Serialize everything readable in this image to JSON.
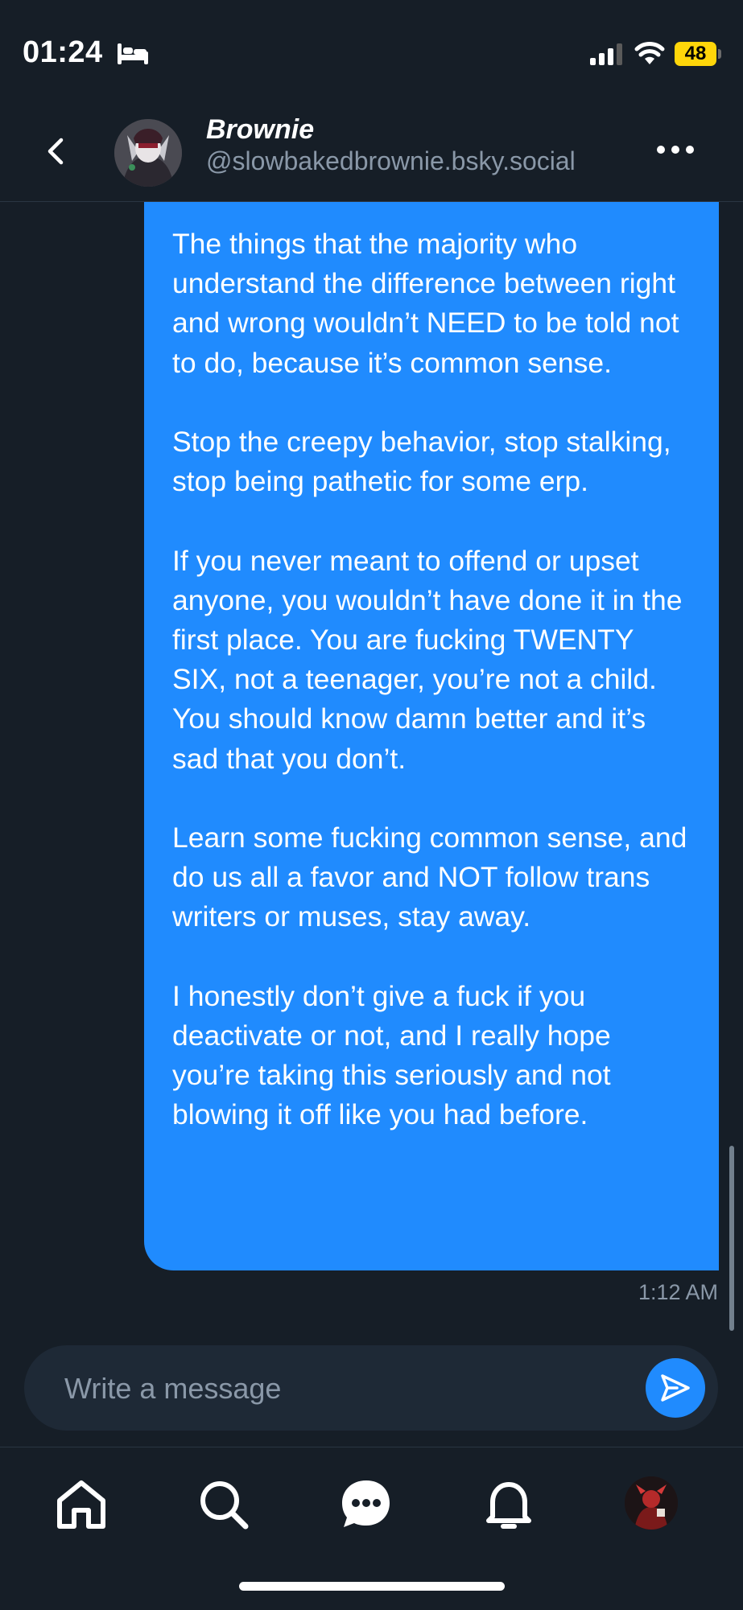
{
  "status_bar": {
    "time": "01:24",
    "battery": "48"
  },
  "header": {
    "name": "Brownie",
    "handle": "@slowbakedbrownie.bsky.social"
  },
  "message": {
    "paragraphs": [
      "The things that the majority who understand the difference between right and wrong wouldn’t NEED to be told not to do, because it’s common sense.",
      "Stop the creepy behavior, stop stalking, stop being pathetic for some erp.",
      "If you never meant to offend or upset anyone, you wouldn’t have done it in the first place. You are fucking TWENTY SIX, not a teenager, you’re not a child. You should know damn better and it’s sad that you don’t.",
      "Learn some fucking common sense, and do us all a favor and NOT follow trans writers or muses, stay away.",
      "I honestly don’t give a fuck if you deactivate or not, and I really hope you’re taking this seriously and not blowing it off like you had before."
    ],
    "timestamp": "1:12 AM"
  },
  "composer": {
    "placeholder": "Write a message"
  },
  "colors": {
    "accent": "#208bfe",
    "background": "#161e27",
    "muted": "#8a98a8"
  }
}
